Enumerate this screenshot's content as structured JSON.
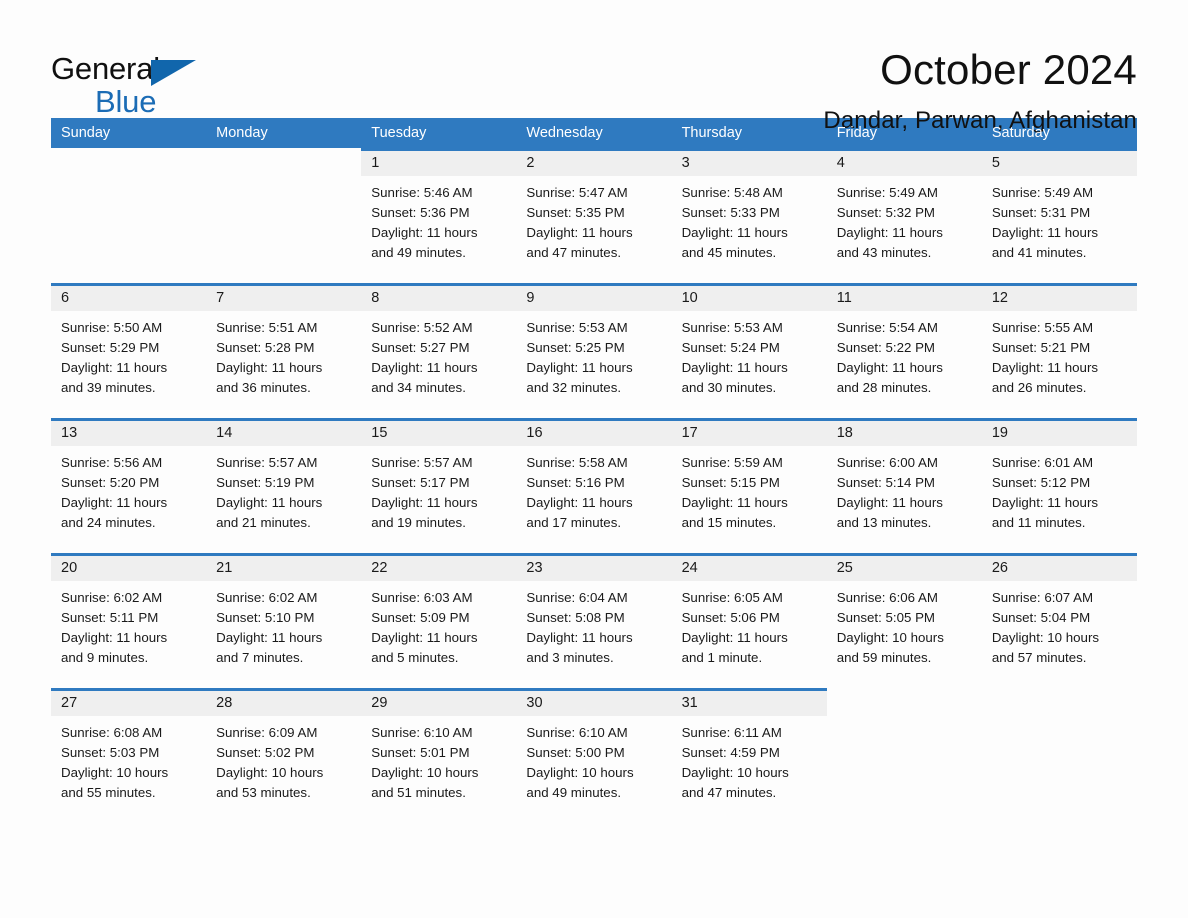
{
  "brand": {
    "line1": "General",
    "line2": "Blue",
    "flag_color": "#1166ac"
  },
  "header": {
    "month_title": "October 2024",
    "location": "Dandar, Parwan, Afghanistan"
  },
  "colors": {
    "header_blue": "#2f7ac0",
    "daynum_gray": "#efefef",
    "page_bg": "#fdfdfd"
  },
  "calendar": {
    "weekday_headers": [
      "Sunday",
      "Monday",
      "Tuesday",
      "Wednesday",
      "Thursday",
      "Friday",
      "Saturday"
    ],
    "weeks": [
      [
        {
          "blank": true
        },
        {
          "blank": true
        },
        {
          "day": "1",
          "sunrise": "Sunrise: 5:46 AM",
          "sunset": "Sunset: 5:36 PM",
          "daylight1": "Daylight: 11 hours",
          "daylight2": "and 49 minutes."
        },
        {
          "day": "2",
          "sunrise": "Sunrise: 5:47 AM",
          "sunset": "Sunset: 5:35 PM",
          "daylight1": "Daylight: 11 hours",
          "daylight2": "and 47 minutes."
        },
        {
          "day": "3",
          "sunrise": "Sunrise: 5:48 AM",
          "sunset": "Sunset: 5:33 PM",
          "daylight1": "Daylight: 11 hours",
          "daylight2": "and 45 minutes."
        },
        {
          "day": "4",
          "sunrise": "Sunrise: 5:49 AM",
          "sunset": "Sunset: 5:32 PM",
          "daylight1": "Daylight: 11 hours",
          "daylight2": "and 43 minutes."
        },
        {
          "day": "5",
          "sunrise": "Sunrise: 5:49 AM",
          "sunset": "Sunset: 5:31 PM",
          "daylight1": "Daylight: 11 hours",
          "daylight2": "and 41 minutes."
        }
      ],
      [
        {
          "day": "6",
          "sunrise": "Sunrise: 5:50 AM",
          "sunset": "Sunset: 5:29 PM",
          "daylight1": "Daylight: 11 hours",
          "daylight2": "and 39 minutes."
        },
        {
          "day": "7",
          "sunrise": "Sunrise: 5:51 AM",
          "sunset": "Sunset: 5:28 PM",
          "daylight1": "Daylight: 11 hours",
          "daylight2": "and 36 minutes."
        },
        {
          "day": "8",
          "sunrise": "Sunrise: 5:52 AM",
          "sunset": "Sunset: 5:27 PM",
          "daylight1": "Daylight: 11 hours",
          "daylight2": "and 34 minutes."
        },
        {
          "day": "9",
          "sunrise": "Sunrise: 5:53 AM",
          "sunset": "Sunset: 5:25 PM",
          "daylight1": "Daylight: 11 hours",
          "daylight2": "and 32 minutes."
        },
        {
          "day": "10",
          "sunrise": "Sunrise: 5:53 AM",
          "sunset": "Sunset: 5:24 PM",
          "daylight1": "Daylight: 11 hours",
          "daylight2": "and 30 minutes."
        },
        {
          "day": "11",
          "sunrise": "Sunrise: 5:54 AM",
          "sunset": "Sunset: 5:22 PM",
          "daylight1": "Daylight: 11 hours",
          "daylight2": "and 28 minutes."
        },
        {
          "day": "12",
          "sunrise": "Sunrise: 5:55 AM",
          "sunset": "Sunset: 5:21 PM",
          "daylight1": "Daylight: 11 hours",
          "daylight2": "and 26 minutes."
        }
      ],
      [
        {
          "day": "13",
          "sunrise": "Sunrise: 5:56 AM",
          "sunset": "Sunset: 5:20 PM",
          "daylight1": "Daylight: 11 hours",
          "daylight2": "and 24 minutes."
        },
        {
          "day": "14",
          "sunrise": "Sunrise: 5:57 AM",
          "sunset": "Sunset: 5:19 PM",
          "daylight1": "Daylight: 11 hours",
          "daylight2": "and 21 minutes."
        },
        {
          "day": "15",
          "sunrise": "Sunrise: 5:57 AM",
          "sunset": "Sunset: 5:17 PM",
          "daylight1": "Daylight: 11 hours",
          "daylight2": "and 19 minutes."
        },
        {
          "day": "16",
          "sunrise": "Sunrise: 5:58 AM",
          "sunset": "Sunset: 5:16 PM",
          "daylight1": "Daylight: 11 hours",
          "daylight2": "and 17 minutes."
        },
        {
          "day": "17",
          "sunrise": "Sunrise: 5:59 AM",
          "sunset": "Sunset: 5:15 PM",
          "daylight1": "Daylight: 11 hours",
          "daylight2": "and 15 minutes."
        },
        {
          "day": "18",
          "sunrise": "Sunrise: 6:00 AM",
          "sunset": "Sunset: 5:14 PM",
          "daylight1": "Daylight: 11 hours",
          "daylight2": "and 13 minutes."
        },
        {
          "day": "19",
          "sunrise": "Sunrise: 6:01 AM",
          "sunset": "Sunset: 5:12 PM",
          "daylight1": "Daylight: 11 hours",
          "daylight2": "and 11 minutes."
        }
      ],
      [
        {
          "day": "20",
          "sunrise": "Sunrise: 6:02 AM",
          "sunset": "Sunset: 5:11 PM",
          "daylight1": "Daylight: 11 hours",
          "daylight2": "and 9 minutes."
        },
        {
          "day": "21",
          "sunrise": "Sunrise: 6:02 AM",
          "sunset": "Sunset: 5:10 PM",
          "daylight1": "Daylight: 11 hours",
          "daylight2": "and 7 minutes."
        },
        {
          "day": "22",
          "sunrise": "Sunrise: 6:03 AM",
          "sunset": "Sunset: 5:09 PM",
          "daylight1": "Daylight: 11 hours",
          "daylight2": "and 5 minutes."
        },
        {
          "day": "23",
          "sunrise": "Sunrise: 6:04 AM",
          "sunset": "Sunset: 5:08 PM",
          "daylight1": "Daylight: 11 hours",
          "daylight2": "and 3 minutes."
        },
        {
          "day": "24",
          "sunrise": "Sunrise: 6:05 AM",
          "sunset": "Sunset: 5:06 PM",
          "daylight1": "Daylight: 11 hours",
          "daylight2": "and 1 minute."
        },
        {
          "day": "25",
          "sunrise": "Sunrise: 6:06 AM",
          "sunset": "Sunset: 5:05 PM",
          "daylight1": "Daylight: 10 hours",
          "daylight2": "and 59 minutes."
        },
        {
          "day": "26",
          "sunrise": "Sunrise: 6:07 AM",
          "sunset": "Sunset: 5:04 PM",
          "daylight1": "Daylight: 10 hours",
          "daylight2": "and 57 minutes."
        }
      ],
      [
        {
          "day": "27",
          "sunrise": "Sunrise: 6:08 AM",
          "sunset": "Sunset: 5:03 PM",
          "daylight1": "Daylight: 10 hours",
          "daylight2": "and 55 minutes."
        },
        {
          "day": "28",
          "sunrise": "Sunrise: 6:09 AM",
          "sunset": "Sunset: 5:02 PM",
          "daylight1": "Daylight: 10 hours",
          "daylight2": "and 53 minutes."
        },
        {
          "day": "29",
          "sunrise": "Sunrise: 6:10 AM",
          "sunset": "Sunset: 5:01 PM",
          "daylight1": "Daylight: 10 hours",
          "daylight2": "and 51 minutes."
        },
        {
          "day": "30",
          "sunrise": "Sunrise: 6:10 AM",
          "sunset": "Sunset: 5:00 PM",
          "daylight1": "Daylight: 10 hours",
          "daylight2": "and 49 minutes."
        },
        {
          "day": "31",
          "sunrise": "Sunrise: 6:11 AM",
          "sunset": "Sunset: 4:59 PM",
          "daylight1": "Daylight: 10 hours",
          "daylight2": "and 47 minutes."
        },
        {
          "blank": true
        },
        {
          "blank": true
        }
      ]
    ]
  }
}
